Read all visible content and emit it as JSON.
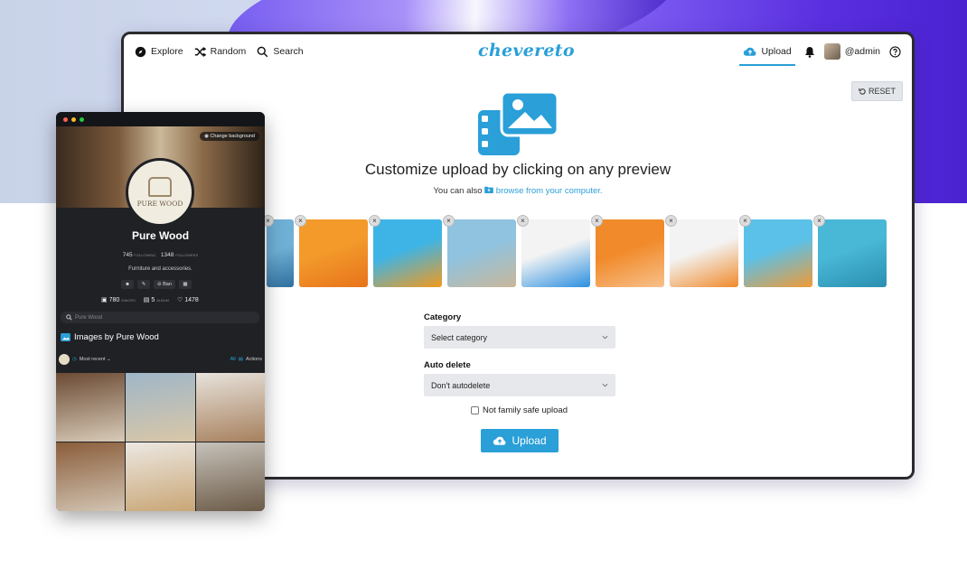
{
  "nav": {
    "explore": "Explore",
    "random": "Random",
    "search": "Search",
    "logo": "chevereto",
    "upload": "Upload",
    "user": "@admin"
  },
  "toolbar": {
    "reset": "RESET"
  },
  "hero": {
    "title": "Customize upload by clicking on any preview",
    "sub_prefix": "You can also",
    "sub_link": "browse from your computer."
  },
  "thumbs": [
    {
      "close": "×",
      "color_a": "#6fb0d6",
      "color_b": "#2f6f9e"
    },
    {
      "close": "×",
      "color_a": "#f39a2b",
      "color_b": "#e7731b"
    },
    {
      "close": "×",
      "color_a": "#3eb4e6",
      "color_b": "#f29a1d"
    },
    {
      "close": "×",
      "color_a": "#8fc3df",
      "color_b": "#c9b79a"
    },
    {
      "close": "×",
      "color_a": "#f3f3f3",
      "color_b": "#2b8fe0"
    },
    {
      "close": "×",
      "color_a": "#f18a2a",
      "color_b": "#f7c08a"
    },
    {
      "close": "×",
      "color_a": "#f3f3f3",
      "color_b": "#f08a2b"
    },
    {
      "close": "×",
      "color_a": "#5cc1e8",
      "color_b": "#f19a35"
    },
    {
      "close": "×",
      "color_a": "#49b7d6",
      "color_b": "#2a8fb0"
    }
  ],
  "form": {
    "category_label": "Category",
    "category_value": "Select category",
    "autodelete_label": "Auto delete",
    "autodelete_value": "Don't autodelete",
    "nsfw_label": "Not family safe upload",
    "upload_button": "Upload"
  },
  "profile": {
    "change_background": "Change background",
    "logo_text": "PURE WOOD",
    "name": "Pure Wood",
    "following_count": "745",
    "following_label": "FOLLOWING",
    "followers_count": "1348",
    "followers_label": "FOLLOWERS",
    "description": "Furniture and accessories.",
    "ban_label": "Ban",
    "images_count": "780",
    "images_label": "IMAGES",
    "albums_count": "5",
    "albums_label": "ALBUM",
    "likes_count": "1478",
    "search_placeholder": "Pure Wood",
    "images_title": "Images by Pure Wood",
    "sort_label": "Most recent",
    "all_label": "All",
    "actions_label": "Actions",
    "grid": [
      {
        "a": "#6b4a33",
        "b": "#d8cbb8"
      },
      {
        "a": "#9fb6c8",
        "b": "#d9c7a8"
      },
      {
        "a": "#e7e3dc",
        "b": "#a7805d"
      },
      {
        "a": "#8a5d3b",
        "b": "#d2c4b2"
      },
      {
        "a": "#ece8e2",
        "b": "#c9a676"
      },
      {
        "a": "#c7c2ba",
        "b": "#6b5a47"
      }
    ]
  },
  "colors": {
    "accent": "#2a9fd8"
  }
}
